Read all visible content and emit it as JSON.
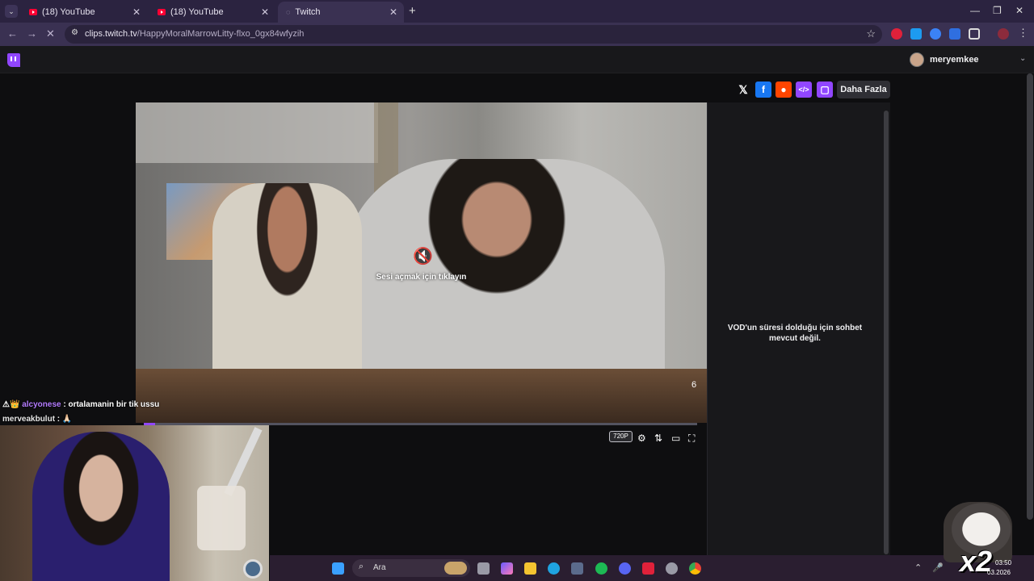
{
  "browser": {
    "tabs": [
      {
        "title": "(18) YouTube"
      },
      {
        "title": "(18) YouTube"
      },
      {
        "title": "Twitch"
      }
    ],
    "new_tab": "+",
    "url_host": "clips.twitch.tv",
    "url_path": "/HappyMoralMarrowLitty-flxo_0gx84wfyzih"
  },
  "twitch": {
    "username": "meryemkee",
    "share_more": "Daha Fazla",
    "unmute_hint": "Sesi açmak için tıklayın",
    "video_counter": "6",
    "progress": 0.02,
    "quality": "720P",
    "chat_unavailable": "VOD'un süresi dolduğu için sohbet mevcut değil."
  },
  "stream_chat": [
    {
      "badges": "⚠👑",
      "user": "alcyonese",
      "message": "ortalamanin bir tik ussu"
    },
    {
      "badges": "",
      "user": "merveakbulut",
      "message": "🙏🏻"
    }
  ],
  "taskbar": {
    "search_label": "Ara",
    "time": "03:50",
    "date": "03.2026"
  },
  "overlay": {
    "multiplier": "x2"
  },
  "colors": {
    "twitch_purple": "#9146ff",
    "browser_frame": "#2b2340"
  }
}
